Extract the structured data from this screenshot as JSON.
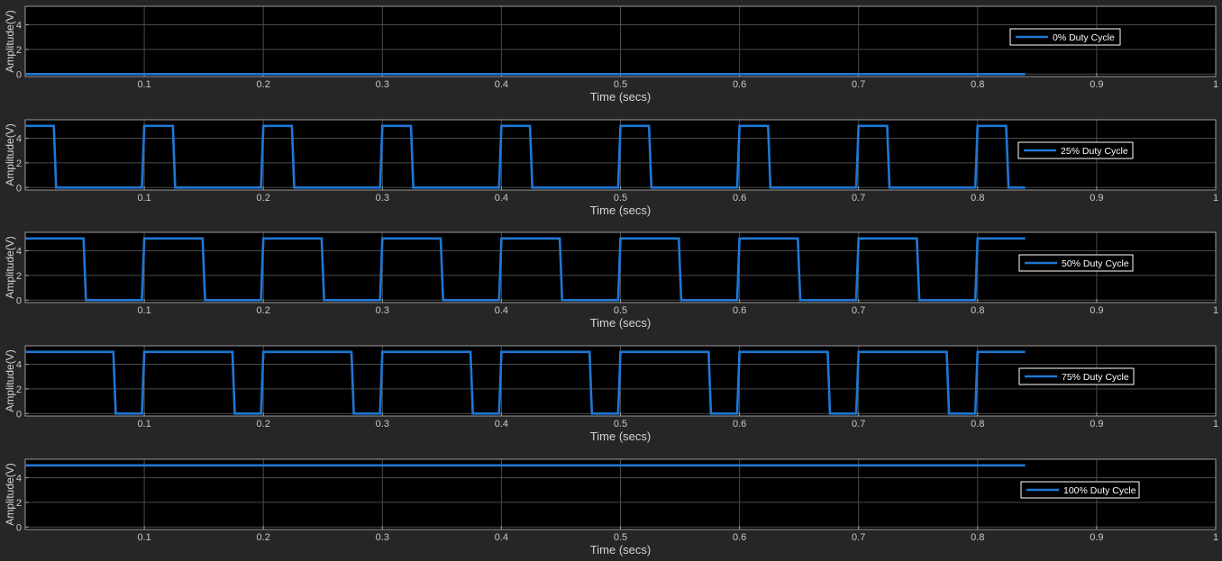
{
  "colors": {
    "figure_bg": "#262626",
    "axes_bg": "#000000",
    "axes_edge": "#9a9a9a",
    "grid": "#4a4a4a",
    "tick_text": "#c8c8c8",
    "label_text": "#d4d4d4",
    "line": "#1f77d4",
    "legend_bg": "#000000",
    "legend_edge": "#ffffff",
    "legend_text": "#ffffff"
  },
  "chart_data": [
    {
      "type": "line",
      "xlabel": "Time (secs)",
      "ylabel": "Amplitude(V)",
      "xlim": [
        0,
        1
      ],
      "ylim": [
        -0.2,
        5.5
      ],
      "xticks": [
        0.1,
        0.2,
        0.3,
        0.4,
        0.5,
        0.6,
        0.7,
        0.8,
        0.9,
        1
      ],
      "xtick_labels": [
        "0.1",
        "0.2",
        "0.3",
        "0.4",
        "0.5",
        "0.6",
        "0.7",
        "0.8",
        "0.9",
        "1"
      ],
      "yticks": [
        0,
        2,
        4
      ],
      "ytick_labels": [
        "0",
        "2",
        "4"
      ],
      "grid": true,
      "legend_position": "right",
      "series": [
        {
          "name": "0% Duty Cycle",
          "waveform": {
            "period": 0.1,
            "duty": 0,
            "high": 5,
            "low": 0,
            "t_start": 0,
            "t_end": 0.84
          }
        }
      ]
    },
    {
      "type": "line",
      "xlabel": "Time (secs)",
      "ylabel": "Amplitude(V)",
      "xlim": [
        0,
        1
      ],
      "ylim": [
        -0.2,
        5.5
      ],
      "xticks": [
        0.1,
        0.2,
        0.3,
        0.4,
        0.5,
        0.6,
        0.7,
        0.8,
        0.9,
        1
      ],
      "xtick_labels": [
        "0.1",
        "0.2",
        "0.3",
        "0.4",
        "0.5",
        "0.6",
        "0.7",
        "0.8",
        "0.9",
        "1"
      ],
      "yticks": [
        0,
        2,
        4
      ],
      "ytick_labels": [
        "0",
        "2",
        "4"
      ],
      "grid": true,
      "legend_position": "right",
      "series": [
        {
          "name": "25% Duty Cycle",
          "waveform": {
            "period": 0.1,
            "duty": 0.25,
            "high": 5,
            "low": 0,
            "t_start": 0,
            "t_end": 0.84
          }
        }
      ]
    },
    {
      "type": "line",
      "xlabel": "Time (secs)",
      "ylabel": "Amplitude(V)",
      "xlim": [
        0,
        1
      ],
      "ylim": [
        -0.2,
        5.5
      ],
      "xticks": [
        0.1,
        0.2,
        0.3,
        0.4,
        0.5,
        0.6,
        0.7,
        0.8,
        0.9,
        1
      ],
      "xtick_labels": [
        "0.1",
        "0.2",
        "0.3",
        "0.4",
        "0.5",
        "0.6",
        "0.7",
        "0.8",
        "0.9",
        "1"
      ],
      "yticks": [
        0,
        2,
        4
      ],
      "ytick_labels": [
        "0",
        "2",
        "4"
      ],
      "grid": true,
      "legend_position": "right",
      "series": [
        {
          "name": "50% Duty Cycle",
          "waveform": {
            "period": 0.1,
            "duty": 0.5,
            "high": 5,
            "low": 0,
            "t_start": 0,
            "t_end": 0.84
          }
        }
      ]
    },
    {
      "type": "line",
      "xlabel": "Time (secs)",
      "ylabel": "Amplitude(V)",
      "xlim": [
        0,
        1
      ],
      "ylim": [
        -0.2,
        5.5
      ],
      "xticks": [
        0.1,
        0.2,
        0.3,
        0.4,
        0.5,
        0.6,
        0.7,
        0.8,
        0.9,
        1
      ],
      "xtick_labels": [
        "0.1",
        "0.2",
        "0.3",
        "0.4",
        "0.5",
        "0.6",
        "0.7",
        "0.8",
        "0.9",
        "1"
      ],
      "yticks": [
        0,
        2,
        4
      ],
      "ytick_labels": [
        "0",
        "2",
        "4"
      ],
      "grid": true,
      "legend_position": "right",
      "series": [
        {
          "name": "75% Duty Cycle",
          "waveform": {
            "period": 0.1,
            "duty": 0.75,
            "high": 5,
            "low": 0,
            "t_start": 0,
            "t_end": 0.84
          }
        }
      ]
    },
    {
      "type": "line",
      "xlabel": "Time (secs)",
      "ylabel": "Amplitude(V)",
      "xlim": [
        0,
        1
      ],
      "ylim": [
        -0.2,
        5.5
      ],
      "xticks": [
        0.1,
        0.2,
        0.3,
        0.4,
        0.5,
        0.6,
        0.7,
        0.8,
        0.9,
        1
      ],
      "xtick_labels": [
        "0.1",
        "0.2",
        "0.3",
        "0.4",
        "0.5",
        "0.6",
        "0.7",
        "0.8",
        "0.9",
        "1"
      ],
      "yticks": [
        0,
        2,
        4
      ],
      "ytick_labels": [
        "0",
        "2",
        "4"
      ],
      "grid": true,
      "legend_position": "right",
      "series": [
        {
          "name": "100% Duty Cycle",
          "waveform": {
            "period": 0.1,
            "duty": 1,
            "high": 5,
            "low": 0,
            "t_start": 0,
            "t_end": 0.84
          }
        }
      ]
    }
  ]
}
